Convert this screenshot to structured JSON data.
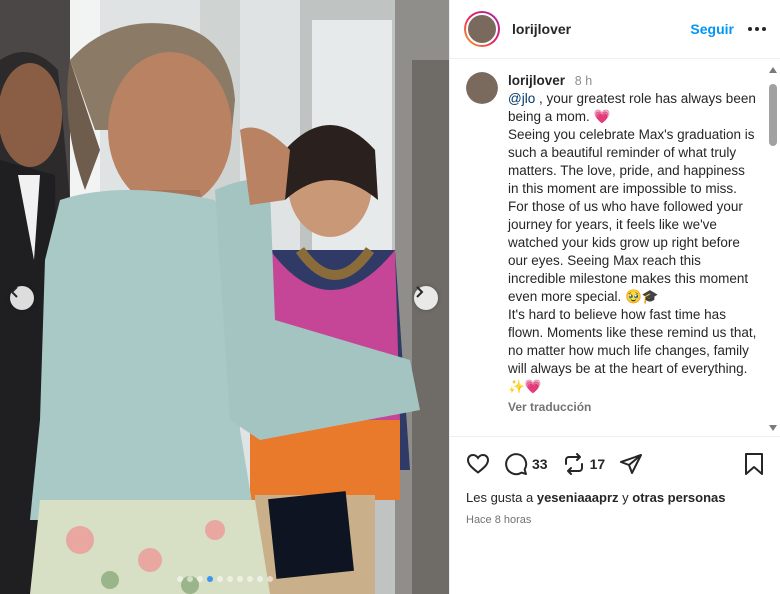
{
  "post": {
    "username": "lorijlover",
    "follow_label": "Seguir",
    "more_label": "Más opciones"
  },
  "caption": {
    "username": "lorijlover",
    "time": "8 h",
    "mention": "@jlo",
    "lines": [
      " , your greatest role has always been being a mom. 💗",
      "Seeing you celebrate Max's graduation is such a beautiful reminder of what truly matters. The love, pride, and happiness in this moment are impossible to miss.",
      "For those of us who have followed your journey for years, it feels like we've watched your kids grow up right before our eyes. Seeing Max reach this incredible milestone makes this moment even more special. 🥹🎓",
      "It's hard to believe how fast time has flown. Moments like these remind us that, no matter how much life changes, family will always be at the heart of everything. ✨💗"
    ],
    "translate_label": "Ver traducción"
  },
  "actions": {
    "comments_count": "33",
    "shares_count": "17"
  },
  "likes": {
    "prefix": "Les gusta a",
    "user": "yeseniaaaprz",
    "joiner": "y",
    "others": "otras personas"
  },
  "timestamp": "Hace 8 horas",
  "carousel": {
    "slide_count": 10,
    "active_index": 3
  },
  "colors": {
    "accent": "#0095f6",
    "sweater": "#a9c9c6",
    "lei": "#d6479b"
  }
}
